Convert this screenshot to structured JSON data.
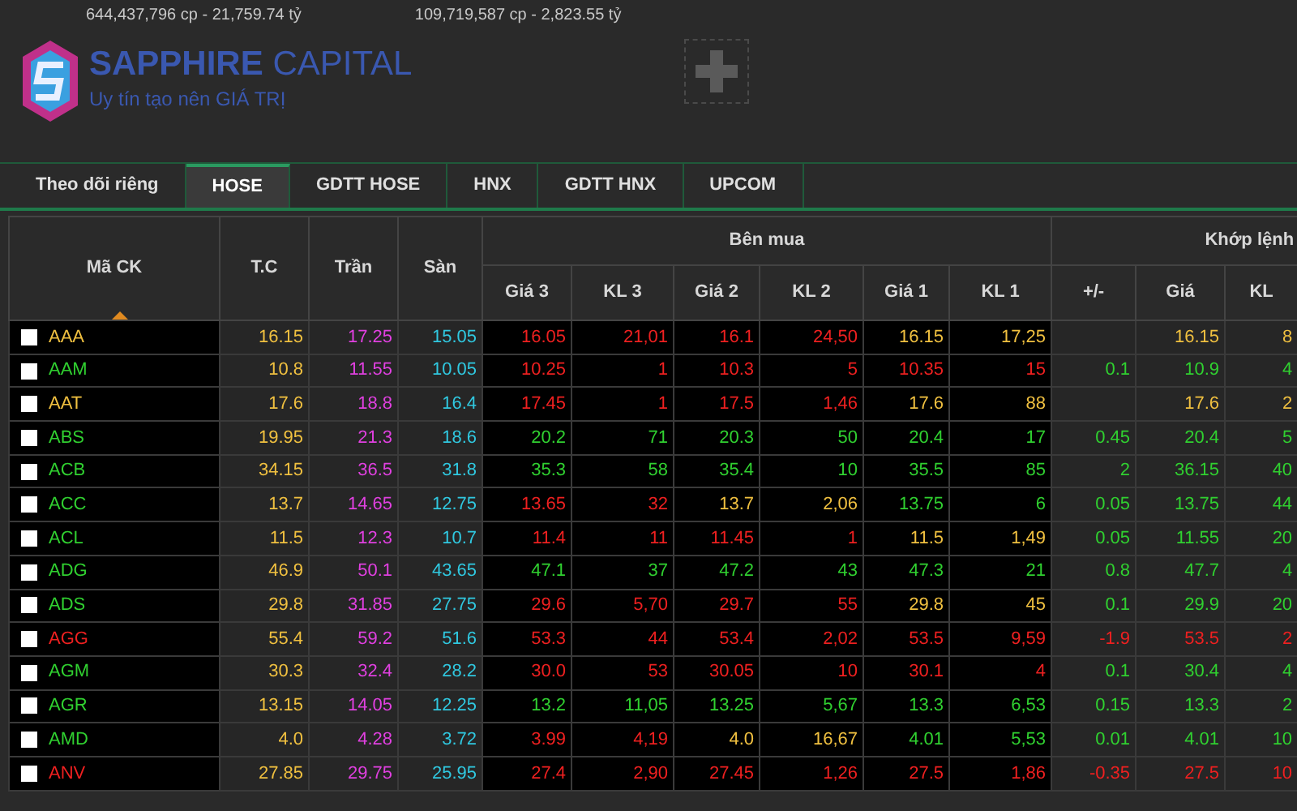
{
  "stats": [
    "644,437,796 cp - 21,759.74 tỷ",
    "109,719,587 cp - 2,823.55 tỷ"
  ],
  "brand": {
    "name_bold": "SAPPHIRE",
    "name_light": "CAPITAL",
    "tagline": "Uy tín tạo nên GIÁ TRỊ"
  },
  "tabs": [
    {
      "label": "Theo dõi riêng",
      "selected": false
    },
    {
      "label": "HOSE",
      "selected": true
    },
    {
      "label": "GDTT HOSE",
      "selected": false
    },
    {
      "label": "HNX",
      "selected": false
    },
    {
      "label": "GDTT HNX",
      "selected": false
    },
    {
      "label": "UPCOM",
      "selected": false
    }
  ],
  "table": {
    "columns": [
      "Mã CK",
      "T.C",
      "Trần",
      "Sàn"
    ],
    "groups": [
      {
        "label": "Bên mua",
        "columns": [
          "Giá 3",
          "KL 3",
          "Giá 2",
          "KL 2",
          "Giá 1",
          "KL 1"
        ]
      },
      {
        "label": "Khớp lệnh",
        "columns": [
          "+/-",
          "Giá",
          "KL"
        ]
      }
    ],
    "rows": [
      {
        "cells": [
          {
            "text": "AAA",
            "kind": "ref",
            "checked": false
          },
          {
            "text": "16.15",
            "kind": "ref"
          },
          {
            "text": "17.25",
            "kind": "ceil"
          },
          {
            "text": "15.05",
            "kind": "floor"
          },
          {
            "text": "16.05",
            "kind": "down"
          },
          {
            "text": "21,01",
            "kind": "down"
          },
          {
            "text": "16.1",
            "kind": "down"
          },
          {
            "text": "24,50",
            "kind": "down"
          },
          {
            "text": "16.15",
            "kind": "ref"
          },
          {
            "text": "17,25",
            "kind": "ref"
          },
          {
            "kind": "blank"
          },
          {
            "text": "16.15",
            "kind": "ref"
          },
          {
            "text": "8",
            "kind": "ref"
          }
        ]
      },
      {
        "cells": [
          {
            "text": "AAM",
            "kind": "up",
            "checked": false
          },
          {
            "text": "10.8",
            "kind": "ref"
          },
          {
            "text": "11.55",
            "kind": "ceil"
          },
          {
            "text": "10.05",
            "kind": "floor"
          },
          {
            "text": "10.25",
            "kind": "down"
          },
          {
            "text": "1",
            "kind": "down"
          },
          {
            "text": "10.3",
            "kind": "down"
          },
          {
            "text": "5",
            "kind": "down"
          },
          {
            "text": "10.35",
            "kind": "down"
          },
          {
            "text": "15",
            "kind": "down"
          },
          {
            "text": "0.1",
            "kind": "up"
          },
          {
            "text": "10.9",
            "kind": "up"
          },
          {
            "text": "4",
            "kind": "up"
          }
        ]
      },
      {
        "cells": [
          {
            "text": "AAT",
            "kind": "ref",
            "checked": false
          },
          {
            "text": "17.6",
            "kind": "ref"
          },
          {
            "text": "18.8",
            "kind": "ceil"
          },
          {
            "text": "16.4",
            "kind": "floor"
          },
          {
            "text": "17.45",
            "kind": "down"
          },
          {
            "text": "1",
            "kind": "down"
          },
          {
            "text": "17.5",
            "kind": "down"
          },
          {
            "text": "1,46",
            "kind": "down"
          },
          {
            "text": "17.6",
            "kind": "ref"
          },
          {
            "text": "88",
            "kind": "ref"
          },
          {
            "kind": "blank"
          },
          {
            "text": "17.6",
            "kind": "ref"
          },
          {
            "text": "2",
            "kind": "ref"
          }
        ]
      },
      {
        "cells": [
          {
            "text": "ABS",
            "kind": "up",
            "checked": false
          },
          {
            "text": "19.95",
            "kind": "ref"
          },
          {
            "text": "21.3",
            "kind": "ceil"
          },
          {
            "text": "18.6",
            "kind": "floor"
          },
          {
            "text": "20.2",
            "kind": "up"
          },
          {
            "text": "71",
            "kind": "up"
          },
          {
            "text": "20.3",
            "kind": "up"
          },
          {
            "text": "50",
            "kind": "up"
          },
          {
            "text": "20.4",
            "kind": "up"
          },
          {
            "text": "17",
            "kind": "up"
          },
          {
            "text": "0.45",
            "kind": "up"
          },
          {
            "text": "20.4",
            "kind": "up"
          },
          {
            "text": "5",
            "kind": "up"
          }
        ]
      },
      {
        "cells": [
          {
            "text": "ACB",
            "kind": "up",
            "checked": false
          },
          {
            "text": "34.15",
            "kind": "ref"
          },
          {
            "text": "36.5",
            "kind": "ceil"
          },
          {
            "text": "31.8",
            "kind": "floor"
          },
          {
            "text": "35.3",
            "kind": "up"
          },
          {
            "text": "58",
            "kind": "up"
          },
          {
            "text": "35.4",
            "kind": "up"
          },
          {
            "text": "10",
            "kind": "up"
          },
          {
            "text": "35.5",
            "kind": "up"
          },
          {
            "text": "85",
            "kind": "up"
          },
          {
            "text": "2",
            "kind": "up"
          },
          {
            "text": "36.15",
            "kind": "up"
          },
          {
            "text": "40",
            "kind": "up"
          }
        ]
      },
      {
        "cells": [
          {
            "text": "ACC",
            "kind": "up",
            "checked": false
          },
          {
            "text": "13.7",
            "kind": "ref"
          },
          {
            "text": "14.65",
            "kind": "ceil"
          },
          {
            "text": "12.75",
            "kind": "floor"
          },
          {
            "text": "13.65",
            "kind": "down"
          },
          {
            "text": "32",
            "kind": "down"
          },
          {
            "text": "13.7",
            "kind": "ref"
          },
          {
            "text": "2,06",
            "kind": "ref"
          },
          {
            "text": "13.75",
            "kind": "up"
          },
          {
            "text": "6",
            "kind": "up"
          },
          {
            "text": "0.05",
            "kind": "up"
          },
          {
            "text": "13.75",
            "kind": "up"
          },
          {
            "text": "44",
            "kind": "up"
          }
        ]
      },
      {
        "cells": [
          {
            "text": "ACL",
            "kind": "up",
            "checked": false
          },
          {
            "text": "11.5",
            "kind": "ref"
          },
          {
            "text": "12.3",
            "kind": "ceil"
          },
          {
            "text": "10.7",
            "kind": "floor"
          },
          {
            "text": "11.4",
            "kind": "down"
          },
          {
            "text": "11",
            "kind": "down"
          },
          {
            "text": "11.45",
            "kind": "down"
          },
          {
            "text": "1",
            "kind": "down"
          },
          {
            "text": "11.5",
            "kind": "ref"
          },
          {
            "text": "1,49",
            "kind": "ref"
          },
          {
            "text": "0.05",
            "kind": "up"
          },
          {
            "text": "11.55",
            "kind": "up"
          },
          {
            "text": "20",
            "kind": "up"
          }
        ]
      },
      {
        "cells": [
          {
            "text": "ADG",
            "kind": "up",
            "checked": false
          },
          {
            "text": "46.9",
            "kind": "ref"
          },
          {
            "text": "50.1",
            "kind": "ceil"
          },
          {
            "text": "43.65",
            "kind": "floor"
          },
          {
            "text": "47.1",
            "kind": "up"
          },
          {
            "text": "37",
            "kind": "up"
          },
          {
            "text": "47.2",
            "kind": "up"
          },
          {
            "text": "43",
            "kind": "up"
          },
          {
            "text": "47.3",
            "kind": "up"
          },
          {
            "text": "21",
            "kind": "up"
          },
          {
            "text": "0.8",
            "kind": "up"
          },
          {
            "text": "47.7",
            "kind": "up"
          },
          {
            "text": "4",
            "kind": "up"
          }
        ]
      },
      {
        "cells": [
          {
            "text": "ADS",
            "kind": "up",
            "checked": false
          },
          {
            "text": "29.8",
            "kind": "ref"
          },
          {
            "text": "31.85",
            "kind": "ceil"
          },
          {
            "text": "27.75",
            "kind": "floor"
          },
          {
            "text": "29.6",
            "kind": "down"
          },
          {
            "text": "5,70",
            "kind": "down"
          },
          {
            "text": "29.7",
            "kind": "down"
          },
          {
            "text": "55",
            "kind": "down"
          },
          {
            "text": "29.8",
            "kind": "ref"
          },
          {
            "text": "45",
            "kind": "ref"
          },
          {
            "text": "0.1",
            "kind": "up"
          },
          {
            "text": "29.9",
            "kind": "up"
          },
          {
            "text": "20",
            "kind": "up"
          }
        ]
      },
      {
        "cells": [
          {
            "text": "AGG",
            "kind": "down",
            "checked": false
          },
          {
            "text": "55.4",
            "kind": "ref"
          },
          {
            "text": "59.2",
            "kind": "ceil"
          },
          {
            "text": "51.6",
            "kind": "floor"
          },
          {
            "text": "53.3",
            "kind": "down"
          },
          {
            "text": "44",
            "kind": "down"
          },
          {
            "text": "53.4",
            "kind": "down"
          },
          {
            "text": "2,02",
            "kind": "down"
          },
          {
            "text": "53.5",
            "kind": "down"
          },
          {
            "text": "9,59",
            "kind": "down"
          },
          {
            "text": "-1.9",
            "kind": "down"
          },
          {
            "text": "53.5",
            "kind": "down"
          },
          {
            "text": "2",
            "kind": "down"
          }
        ]
      },
      {
        "cells": [
          {
            "text": "AGM",
            "kind": "up",
            "checked": false
          },
          {
            "text": "30.3",
            "kind": "ref"
          },
          {
            "text": "32.4",
            "kind": "ceil"
          },
          {
            "text": "28.2",
            "kind": "floor"
          },
          {
            "text": "30.0",
            "kind": "down"
          },
          {
            "text": "53",
            "kind": "down"
          },
          {
            "text": "30.05",
            "kind": "down"
          },
          {
            "text": "10",
            "kind": "down"
          },
          {
            "text": "30.1",
            "kind": "down"
          },
          {
            "text": "4",
            "kind": "down"
          },
          {
            "text": "0.1",
            "kind": "up"
          },
          {
            "text": "30.4",
            "kind": "up"
          },
          {
            "text": "4",
            "kind": "up"
          }
        ]
      },
      {
        "cells": [
          {
            "text": "AGR",
            "kind": "up",
            "checked": false
          },
          {
            "text": "13.15",
            "kind": "ref"
          },
          {
            "text": "14.05",
            "kind": "ceil"
          },
          {
            "text": "12.25",
            "kind": "floor"
          },
          {
            "text": "13.2",
            "kind": "up"
          },
          {
            "text": "11,05",
            "kind": "up"
          },
          {
            "text": "13.25",
            "kind": "up"
          },
          {
            "text": "5,67",
            "kind": "up"
          },
          {
            "text": "13.3",
            "kind": "up"
          },
          {
            "text": "6,53",
            "kind": "up"
          },
          {
            "text": "0.15",
            "kind": "up"
          },
          {
            "text": "13.3",
            "kind": "up"
          },
          {
            "text": "2",
            "kind": "up"
          }
        ]
      },
      {
        "cells": [
          {
            "text": "AMD",
            "kind": "up",
            "checked": false
          },
          {
            "text": "4.0",
            "kind": "ref"
          },
          {
            "text": "4.28",
            "kind": "ceil"
          },
          {
            "text": "3.72",
            "kind": "floor"
          },
          {
            "text": "3.99",
            "kind": "down"
          },
          {
            "text": "4,19",
            "kind": "down"
          },
          {
            "text": "4.0",
            "kind": "ref"
          },
          {
            "text": "16,67",
            "kind": "ref"
          },
          {
            "text": "4.01",
            "kind": "up"
          },
          {
            "text": "5,53",
            "kind": "up"
          },
          {
            "text": "0.01",
            "kind": "up"
          },
          {
            "text": "4.01",
            "kind": "up"
          },
          {
            "text": "10",
            "kind": "up"
          }
        ]
      },
      {
        "cells": [
          {
            "text": "ANV",
            "kind": "down",
            "checked": false
          },
          {
            "text": "27.85",
            "kind": "ref"
          },
          {
            "text": "29.75",
            "kind": "ceil"
          },
          {
            "text": "25.95",
            "kind": "floor"
          },
          {
            "text": "27.4",
            "kind": "down"
          },
          {
            "text": "2,90",
            "kind": "down"
          },
          {
            "text": "27.45",
            "kind": "down"
          },
          {
            "text": "1,26",
            "kind": "down"
          },
          {
            "text": "27.5",
            "kind": "down"
          },
          {
            "text": "1,86",
            "kind": "down"
          },
          {
            "text": "-0.35",
            "kind": "down"
          },
          {
            "text": "27.5",
            "kind": "down"
          },
          {
            "text": "10",
            "kind": "down"
          }
        ]
      }
    ]
  }
}
